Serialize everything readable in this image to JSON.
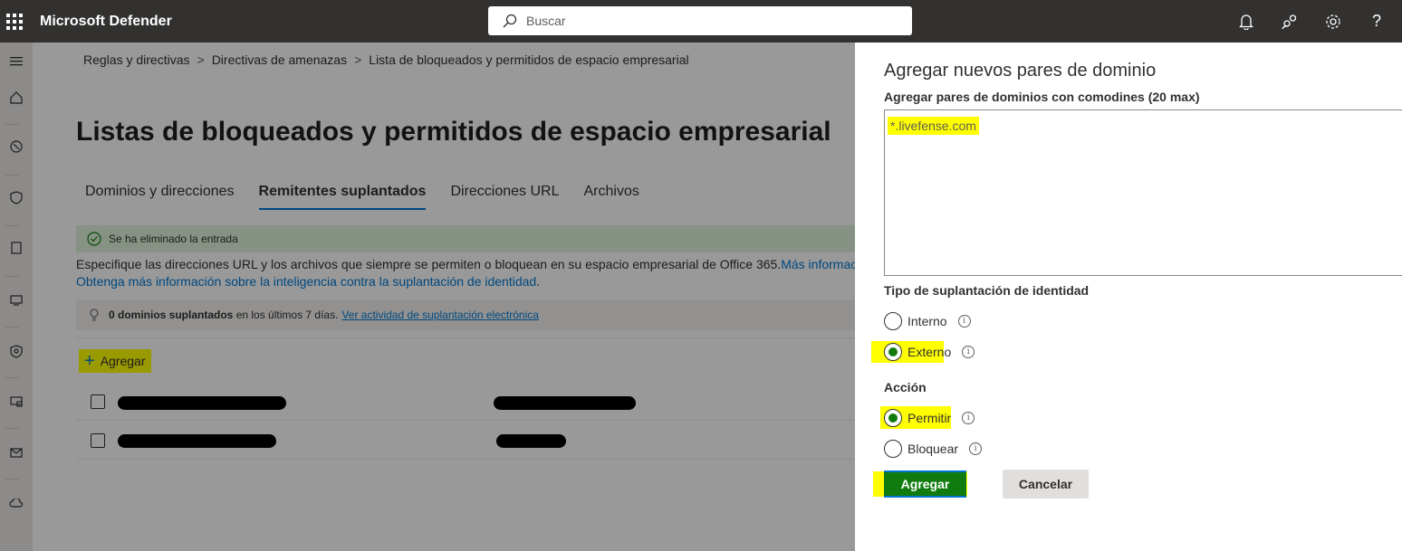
{
  "app": {
    "brand": "Microsoft Defender"
  },
  "search": {
    "placeholder": "Buscar"
  },
  "top_icons": [
    "bell-icon",
    "community-icon",
    "gear-icon",
    "help-icon"
  ],
  "rail_icons": [
    "menu-icon",
    "home-icon",
    "incidents-icon",
    "shield-icon",
    "device-icon",
    "endpoints-icon",
    "secure-score-icon",
    "email-icon",
    "mail-icon",
    "cloud-icon"
  ],
  "breadcrumb": [
    "Reglas y directivas",
    "Directivas de amenazas",
    "Lista de bloqueados y permitidos de espacio empresarial"
  ],
  "page": {
    "title": "Listas de bloqueados y permitidos de espacio empresarial",
    "tabs": [
      {
        "label": "Dominios y direcciones",
        "active": false
      },
      {
        "label": "Remitentes suplantados",
        "active": true
      },
      {
        "label": "Direcciones URL",
        "active": false
      },
      {
        "label": "Archivos",
        "active": false
      }
    ],
    "success_message": "Se ha eliminado la entrada",
    "description_line1": "Especifique las direcciones URL y los archivos que siempre se permiten o bloquean en su espacio empresarial de Office 365.",
    "description_link1": "Más información",
    "description_link2": "Obtenga más información sobre la inteligencia contra la suplantación de identidad",
    "description_period": ".",
    "info_count": "0 dominios suplantados",
    "info_text": "en los últimos 7 días.",
    "info_link": "Ver actividad de suplantación electrónica",
    "add_label": "Agregar"
  },
  "panel": {
    "title": "Agregar nuevos pares de dominio",
    "subtitle": "Agregar pares de dominios con comodines (20 max)",
    "textarea_value": "*.livefense.com",
    "spoof_type_label": "Tipo de suplantación de identidad",
    "spoof_options": [
      {
        "label": "Interno",
        "selected": false
      },
      {
        "label": "Externo",
        "selected": true
      }
    ],
    "action_label": "Acción",
    "action_options": [
      {
        "label": "Permitir",
        "selected": true
      },
      {
        "label": "Bloquear",
        "selected": false
      }
    ],
    "primary_button": "Agregar",
    "secondary_button": "Cancelar"
  },
  "colors": {
    "accent": "#0078d4",
    "primary_button": "#107c10",
    "highlight": "#ffff00",
    "topbar": "#323130"
  }
}
